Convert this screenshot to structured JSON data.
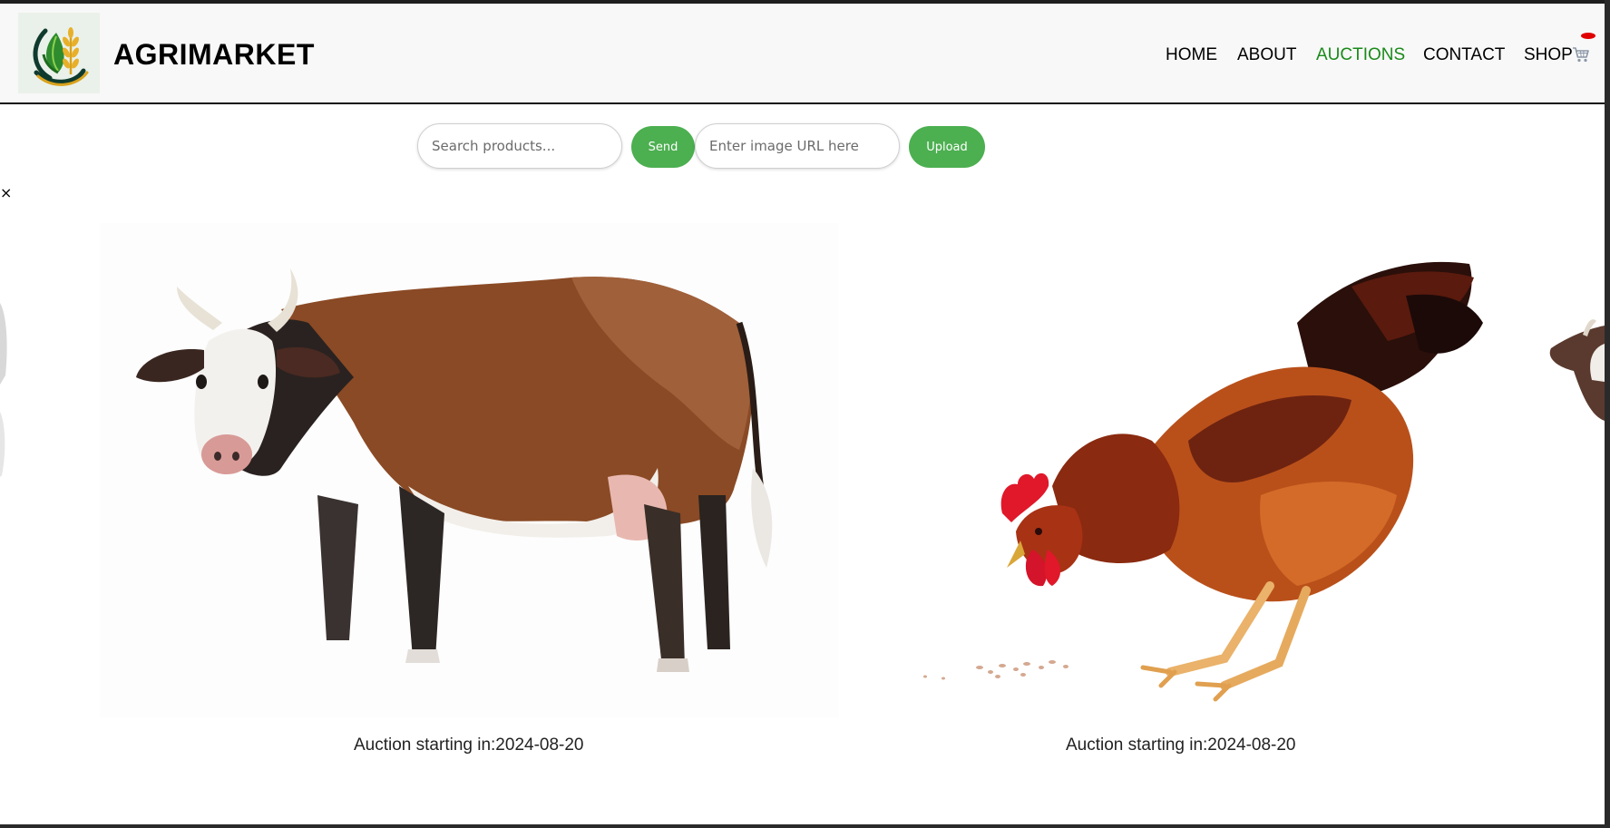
{
  "header": {
    "brand": "AGRIMARKET",
    "nav": [
      {
        "label": "HOME",
        "active": false
      },
      {
        "label": "ABOUT",
        "active": false
      },
      {
        "label": "AUCTIONS",
        "active": true
      },
      {
        "label": "CONTACT",
        "active": false
      },
      {
        "label": "SHOP",
        "active": false
      }
    ],
    "cart_icon": "shopping-cart-icon",
    "active_color": "#1a8a1a"
  },
  "search": {
    "product_placeholder": "Search products...",
    "send_label": "Send",
    "image_url_placeholder": "Enter image URL here",
    "upload_label": "Upload",
    "button_color": "#4caf50"
  },
  "close_label": "×",
  "auctions": [
    {
      "animal": "cow",
      "caption": "Auction starting in:2024-08-20"
    },
    {
      "animal": "rooster",
      "caption": "Auction starting in:2024-08-20"
    }
  ]
}
